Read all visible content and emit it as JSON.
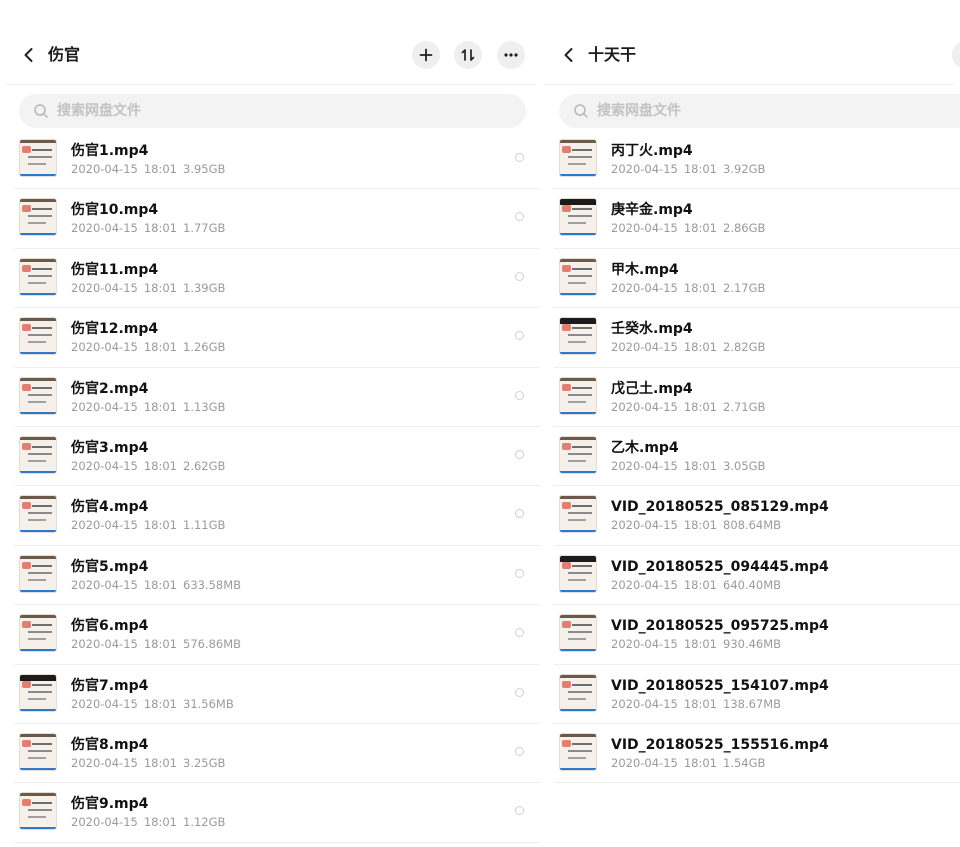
{
  "left": {
    "title": "伤官",
    "search_placeholder": "搜索网盘文件",
    "files": [
      {
        "name": "伤官1.mp4",
        "date": "2020-04-15",
        "time": "18:01",
        "size": "3.95GB"
      },
      {
        "name": "伤官10.mp4",
        "date": "2020-04-15",
        "time": "18:01",
        "size": "1.77GB"
      },
      {
        "name": "伤官11.mp4",
        "date": "2020-04-15",
        "time": "18:01",
        "size": "1.39GB"
      },
      {
        "name": "伤官12.mp4",
        "date": "2020-04-15",
        "time": "18:01",
        "size": "1.26GB"
      },
      {
        "name": "伤官2.mp4",
        "date": "2020-04-15",
        "time": "18:01",
        "size": "1.13GB"
      },
      {
        "name": "伤官3.mp4",
        "date": "2020-04-15",
        "time": "18:01",
        "size": "2.62GB"
      },
      {
        "name": "伤官4.mp4",
        "date": "2020-04-15",
        "time": "18:01",
        "size": "1.11GB"
      },
      {
        "name": "伤官5.mp4",
        "date": "2020-04-15",
        "time": "18:01",
        "size": "633.58MB"
      },
      {
        "name": "伤官6.mp4",
        "date": "2020-04-15",
        "time": "18:01",
        "size": "576.86MB"
      },
      {
        "name": "伤官7.mp4",
        "date": "2020-04-15",
        "time": "18:01",
        "size": "31.56MB"
      },
      {
        "name": "伤官8.mp4",
        "date": "2020-04-15",
        "time": "18:01",
        "size": "3.25GB"
      },
      {
        "name": "伤官9.mp4",
        "date": "2020-04-15",
        "time": "18:01",
        "size": "1.12GB"
      }
    ]
  },
  "right": {
    "title": "十天干",
    "search_placeholder": "搜索网盘文件",
    "files": [
      {
        "name": "丙丁火.mp4",
        "date": "2020-04-15",
        "time": "18:01",
        "size": "3.92GB"
      },
      {
        "name": "庚辛金.mp4",
        "date": "2020-04-15",
        "time": "18:01",
        "size": "2.86GB"
      },
      {
        "name": "甲木.mp4",
        "date": "2020-04-15",
        "time": "18:01",
        "size": "2.17GB"
      },
      {
        "name": "壬癸水.mp4",
        "date": "2020-04-15",
        "time": "18:01",
        "size": "2.82GB"
      },
      {
        "name": "戊己土.mp4",
        "date": "2020-04-15",
        "time": "18:01",
        "size": "2.71GB"
      },
      {
        "name": "乙木.mp4",
        "date": "2020-04-15",
        "time": "18:01",
        "size": "3.05GB"
      },
      {
        "name": "VID_20180525_085129.mp4",
        "date": "2020-04-15",
        "time": "18:01",
        "size": "808.64MB"
      },
      {
        "name": "VID_20180525_094445.mp4",
        "date": "2020-04-15",
        "time": "18:01",
        "size": "640.40MB"
      },
      {
        "name": "VID_20180525_095725.mp4",
        "date": "2020-04-15",
        "time": "18:01",
        "size": "930.46MB"
      },
      {
        "name": "VID_20180525_154107.mp4",
        "date": "2020-04-15",
        "time": "18:01",
        "size": "138.67MB"
      },
      {
        "name": "VID_20180525_155516.mp4",
        "date": "2020-04-15",
        "time": "18:01",
        "size": "1.54GB"
      }
    ]
  },
  "icons": {
    "back": "chevron-left-icon",
    "add": "plus-icon",
    "sort": "sort-arrows-icon",
    "more": "more-horizontal-icon",
    "search": "search-icon"
  },
  "colors": {
    "title_text": "#1a1a1a",
    "meta_text": "#9a9a9a",
    "placeholder_text": "#c3c3c3",
    "search_bg": "#f3f3f3",
    "button_bg": "#efefef"
  }
}
